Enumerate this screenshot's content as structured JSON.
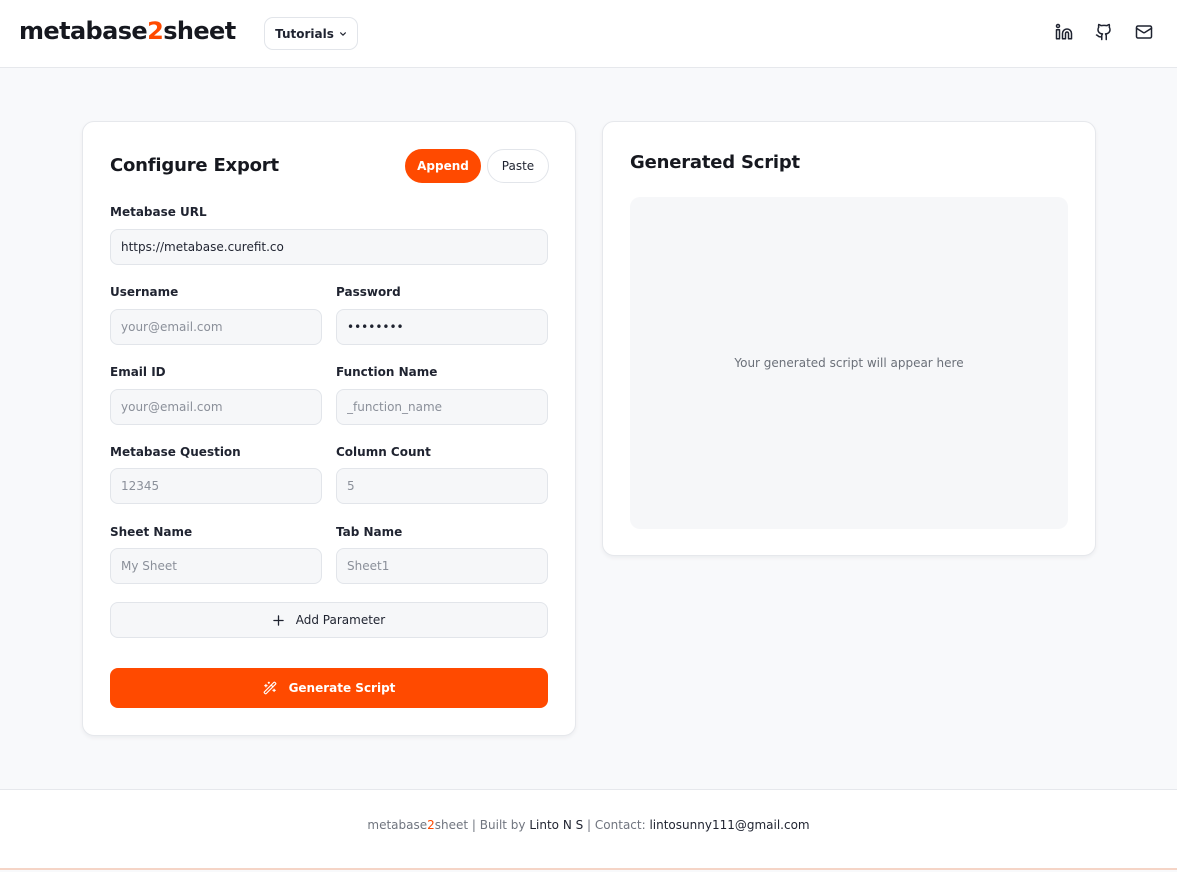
{
  "brand": {
    "name_before": "metabase",
    "name_accent": "2",
    "name_after": "sheet",
    "accent_color": "#ff4a00"
  },
  "header": {
    "tutorials_label": "Tutorials",
    "icons": [
      "linkedin-icon",
      "github-icon",
      "mail-icon"
    ]
  },
  "config": {
    "title": "Configure Export",
    "modes": {
      "active": "Append",
      "inactive": "Paste"
    },
    "fields": {
      "metabase_url": {
        "label": "Metabase URL",
        "value": "https://metabase.curefit.co",
        "placeholder": ""
      },
      "username": {
        "label": "Username",
        "value": "",
        "placeholder": "your@email.com"
      },
      "password": {
        "label": "Password",
        "value": "••••••••",
        "placeholder": ""
      },
      "email_id": {
        "label": "Email ID",
        "value": "",
        "placeholder": "your@email.com"
      },
      "function_name": {
        "label": "Function Name",
        "value": "",
        "placeholder": "_function_name"
      },
      "metabase_question": {
        "label": "Metabase Question",
        "value": "",
        "placeholder": "12345"
      },
      "column_count": {
        "label": "Column Count",
        "value": "",
        "placeholder": "5"
      },
      "sheet_name": {
        "label": "Sheet Name",
        "value": "",
        "placeholder": "My Sheet"
      },
      "tab_name": {
        "label": "Tab Name",
        "value": "",
        "placeholder": "Sheet1"
      }
    },
    "add_parameter_label": "Add Parameter",
    "generate_label": "Generate Script"
  },
  "script": {
    "title": "Generated Script",
    "placeholder": "Your generated script will appear here"
  },
  "footer": {
    "brand_before": "metabase",
    "brand_accent": "2",
    "brand_after": "sheet",
    "built_by_prefix": " | Built by ",
    "author": "Linto N S",
    "contact_prefix": " | Contact: ",
    "email": "lintosunny111@gmail.com"
  }
}
